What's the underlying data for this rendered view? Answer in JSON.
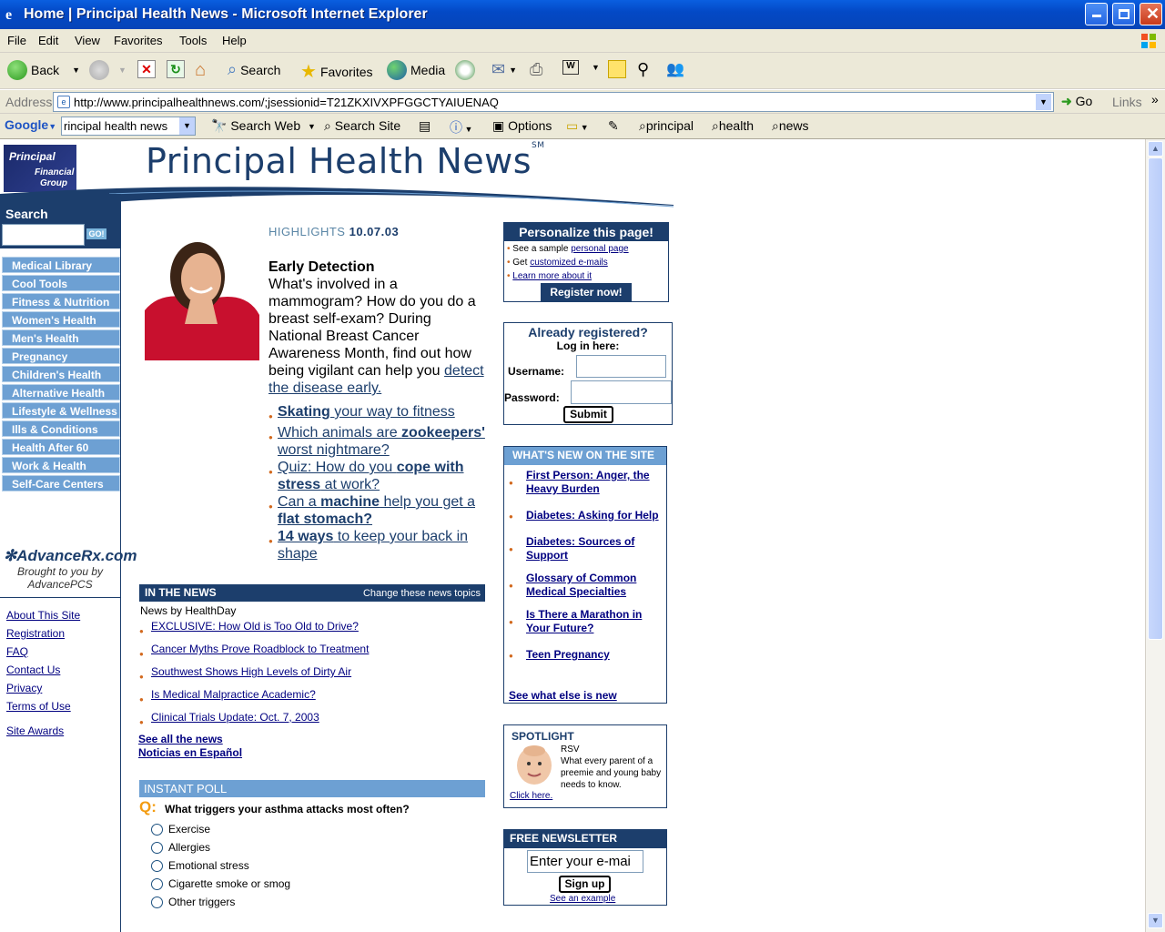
{
  "window": {
    "title": "Home | Principal Health News - Microsoft Internet Explorer"
  },
  "menu": [
    "File",
    "Edit",
    "View",
    "Favorites",
    "Tools",
    "Help"
  ],
  "toolbar": {
    "back": "Back",
    "search": "Search",
    "favorites": "Favorites",
    "media": "Media"
  },
  "address": {
    "label": "Address",
    "url": "http://www.principalhealthnews.com/;jsessionid=T21ZKXIVXPFGGCTYAIUENAQ",
    "go": "Go",
    "links": "Links"
  },
  "google": {
    "brand": "Google",
    "query": "rincipal health news",
    "search_web": "Search Web",
    "search_site": "Search Site",
    "options": "Options",
    "terms": [
      "principal",
      "health",
      "news"
    ]
  },
  "header": {
    "logo_line1": "Principal",
    "logo_line2": "Financial",
    "logo_line3": "Group",
    "site_title": "Principal Health News",
    "sm": "SM"
  },
  "leftnav": {
    "search_label": "Search",
    "go": "GO!",
    "items": [
      "Medical Library",
      "Cool Tools",
      "Fitness & Nutrition",
      "Women's Health",
      "Men's Health",
      "Pregnancy",
      "Children's Health",
      "Alternative  Health",
      "Lifestyle & Wellness",
      "Ills & Conditions",
      "Health After 60",
      "Work & Health",
      "Self-Care Centers"
    ],
    "advancerx_brand": "AdvanceRx.com",
    "brought_by": "Brought to you by",
    "advancepcs": "AdvancePCS",
    "footer_links": [
      "About This Site",
      "Registration",
      "FAQ",
      "Contact Us",
      "Privacy",
      "Terms of Use"
    ],
    "site_awards": "Site Awards"
  },
  "highlights": {
    "label": "HIGHLIGHTS",
    "date": "10.07.03",
    "feature_title": "Early Detection",
    "feature_text": "What's involved in a mammogram? How do you do a breast self-exam? During National Breast Cancer Awareness Month, find out how being vigilant can help you",
    "feature_link": "detect the disease early.",
    "links": [
      {
        "bold": "Skating",
        "rest": " your way to fitness"
      },
      {
        "pre": "Which animals are ",
        "bold": "zookeepers'",
        "rest": " worst nightmare?"
      },
      {
        "pre": "Quiz: How do you ",
        "bold": "cope with stress",
        "rest": " at work?"
      },
      {
        "pre": "Can a ",
        "bold": "machine",
        "rest": " help you get a ",
        "bold2": "flat stomach?"
      },
      {
        "bold": "14 ways",
        "rest": " to keep your back in shape"
      }
    ]
  },
  "news": {
    "title": "IN THE NEWS",
    "change": "Change these news topics",
    "source": "News by HealthDay",
    "items": [
      "EXCLUSIVE: How Old is Too Old to Drive?",
      "Cancer Myths Prove Roadblock to Treatment",
      "Southwest Shows High Levels of Dirty Air",
      "Is Medical Malpractice Academic?",
      "Clinical Trials Update: Oct. 7, 2003"
    ],
    "see_all": "See all the news",
    "espanol": "Noticias en Español"
  },
  "poll": {
    "title": "INSTANT POLL",
    "q": "Q:",
    "question": "What triggers your asthma attacks most often?",
    "options": [
      "Exercise",
      "Allergies",
      "Emotional stress",
      "Cigarette smoke or smog",
      "Other triggers"
    ]
  },
  "personalize": {
    "title": "Personalize this page!",
    "l1_pre": "See a sample ",
    "l1_link": "personal page",
    "l2_pre": "Get ",
    "l2_link": "customized e-mails",
    "l3_link": "Learn more about it",
    "register": "Register now!"
  },
  "login": {
    "title": "Already registered?",
    "subtitle": "Log in here:",
    "username": "Username:",
    "password": "Password:",
    "submit": "Submit"
  },
  "whatsnew": {
    "title": "WHAT'S NEW ON THE SITE",
    "items": [
      "First Person: Anger, the Heavy Burden",
      "Diabetes: Asking for Help",
      "Diabetes: Sources of Support",
      "Glossary of Common Medical Specialties",
      "Is There a Marathon in Your Future?",
      "Teen Pregnancy"
    ],
    "more": "See what else is new"
  },
  "spotlight": {
    "title": "SPOTLIGHT",
    "topic": "RSV",
    "text": "What every parent of a preemie and young baby needs to know.",
    "link": "Click here."
  },
  "newsletter": {
    "title": "FREE NEWSLETTER",
    "email_value": "Enter your e-mai",
    "signup": "Sign up",
    "example": "See an example"
  }
}
